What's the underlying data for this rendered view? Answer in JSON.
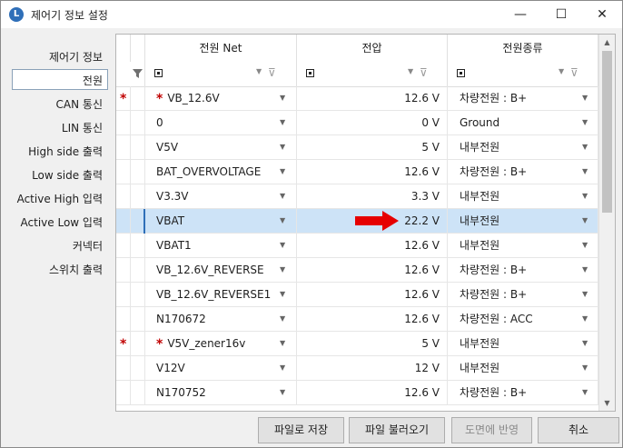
{
  "window": {
    "icon_letter": "L",
    "title": "제어기 정보 설정",
    "minimize_glyph": "—",
    "maximize_glyph": "☐",
    "close_glyph": "✕"
  },
  "sidebar": {
    "items": [
      {
        "label": "제어기 정보"
      },
      {
        "label": "전원",
        "selected": true
      },
      {
        "label": "CAN 통신"
      },
      {
        "label": "LIN 통신"
      },
      {
        "label": "High side 출력"
      },
      {
        "label": "Low side 출력"
      },
      {
        "label": "Active High 입력"
      },
      {
        "label": "Active Low 입력"
      },
      {
        "label": "커넥터"
      },
      {
        "label": "스위치 출력"
      }
    ]
  },
  "grid": {
    "columns": [
      "전원 Net",
      "전압",
      "전원종류"
    ],
    "filter": {
      "icon": "funnel-icon",
      "clear_icon": "clear-filter-icon"
    },
    "rows": [
      {
        "marker": "*",
        "net_prefix": "*",
        "net": "VB_12.6V",
        "voltage": "12.6 V",
        "type": "차량전원 : B+"
      },
      {
        "marker": "",
        "net_prefix": "",
        "net": "0",
        "voltage": "0 V",
        "type": "Ground"
      },
      {
        "marker": "",
        "net_prefix": "",
        "net": "V5V",
        "voltage": "5 V",
        "type": "내부전원"
      },
      {
        "marker": "",
        "net_prefix": "",
        "net": "BAT_OVERVOLTAGE",
        "voltage": "12.6 V",
        "type": "차량전원 : B+"
      },
      {
        "marker": "",
        "net_prefix": "",
        "net": "V3.3V",
        "voltage": "3.3 V",
        "type": "내부전원"
      },
      {
        "marker": "",
        "net_prefix": "",
        "net": "VBAT",
        "voltage": "22.2 V",
        "type": "내부전원",
        "selected": true
      },
      {
        "marker": "",
        "net_prefix": "",
        "net": "VBAT1",
        "voltage": "12.6 V",
        "type": "내부전원"
      },
      {
        "marker": "",
        "net_prefix": "",
        "net": "VB_12.6V_REVERSE",
        "voltage": "12.6 V",
        "type": "차량전원 : B+"
      },
      {
        "marker": "",
        "net_prefix": "",
        "net": "VB_12.6V_REVERSE1",
        "voltage": "12.6 V",
        "type": "차량전원 : B+"
      },
      {
        "marker": "",
        "net_prefix": "",
        "net": "N170672",
        "voltage": "12.6 V",
        "type": "차량전원 : ACC"
      },
      {
        "marker": "*",
        "net_prefix": "*",
        "net": "V5V_zener16v",
        "voltage": "5 V",
        "type": "내부전원"
      },
      {
        "marker": "",
        "net_prefix": "",
        "net": "V12V",
        "voltage": "12 V",
        "type": "내부전원"
      },
      {
        "marker": "",
        "net_prefix": "",
        "net": "N170752",
        "voltage": "12.6 V",
        "type": "차량전원 : B+"
      }
    ],
    "annotation_color": "#e60000",
    "marker_color": "#c00000"
  },
  "buttons": {
    "save": "파일로 저장",
    "load": "파일 불러오기",
    "apply": "도면에 반영",
    "cancel": "취소"
  }
}
